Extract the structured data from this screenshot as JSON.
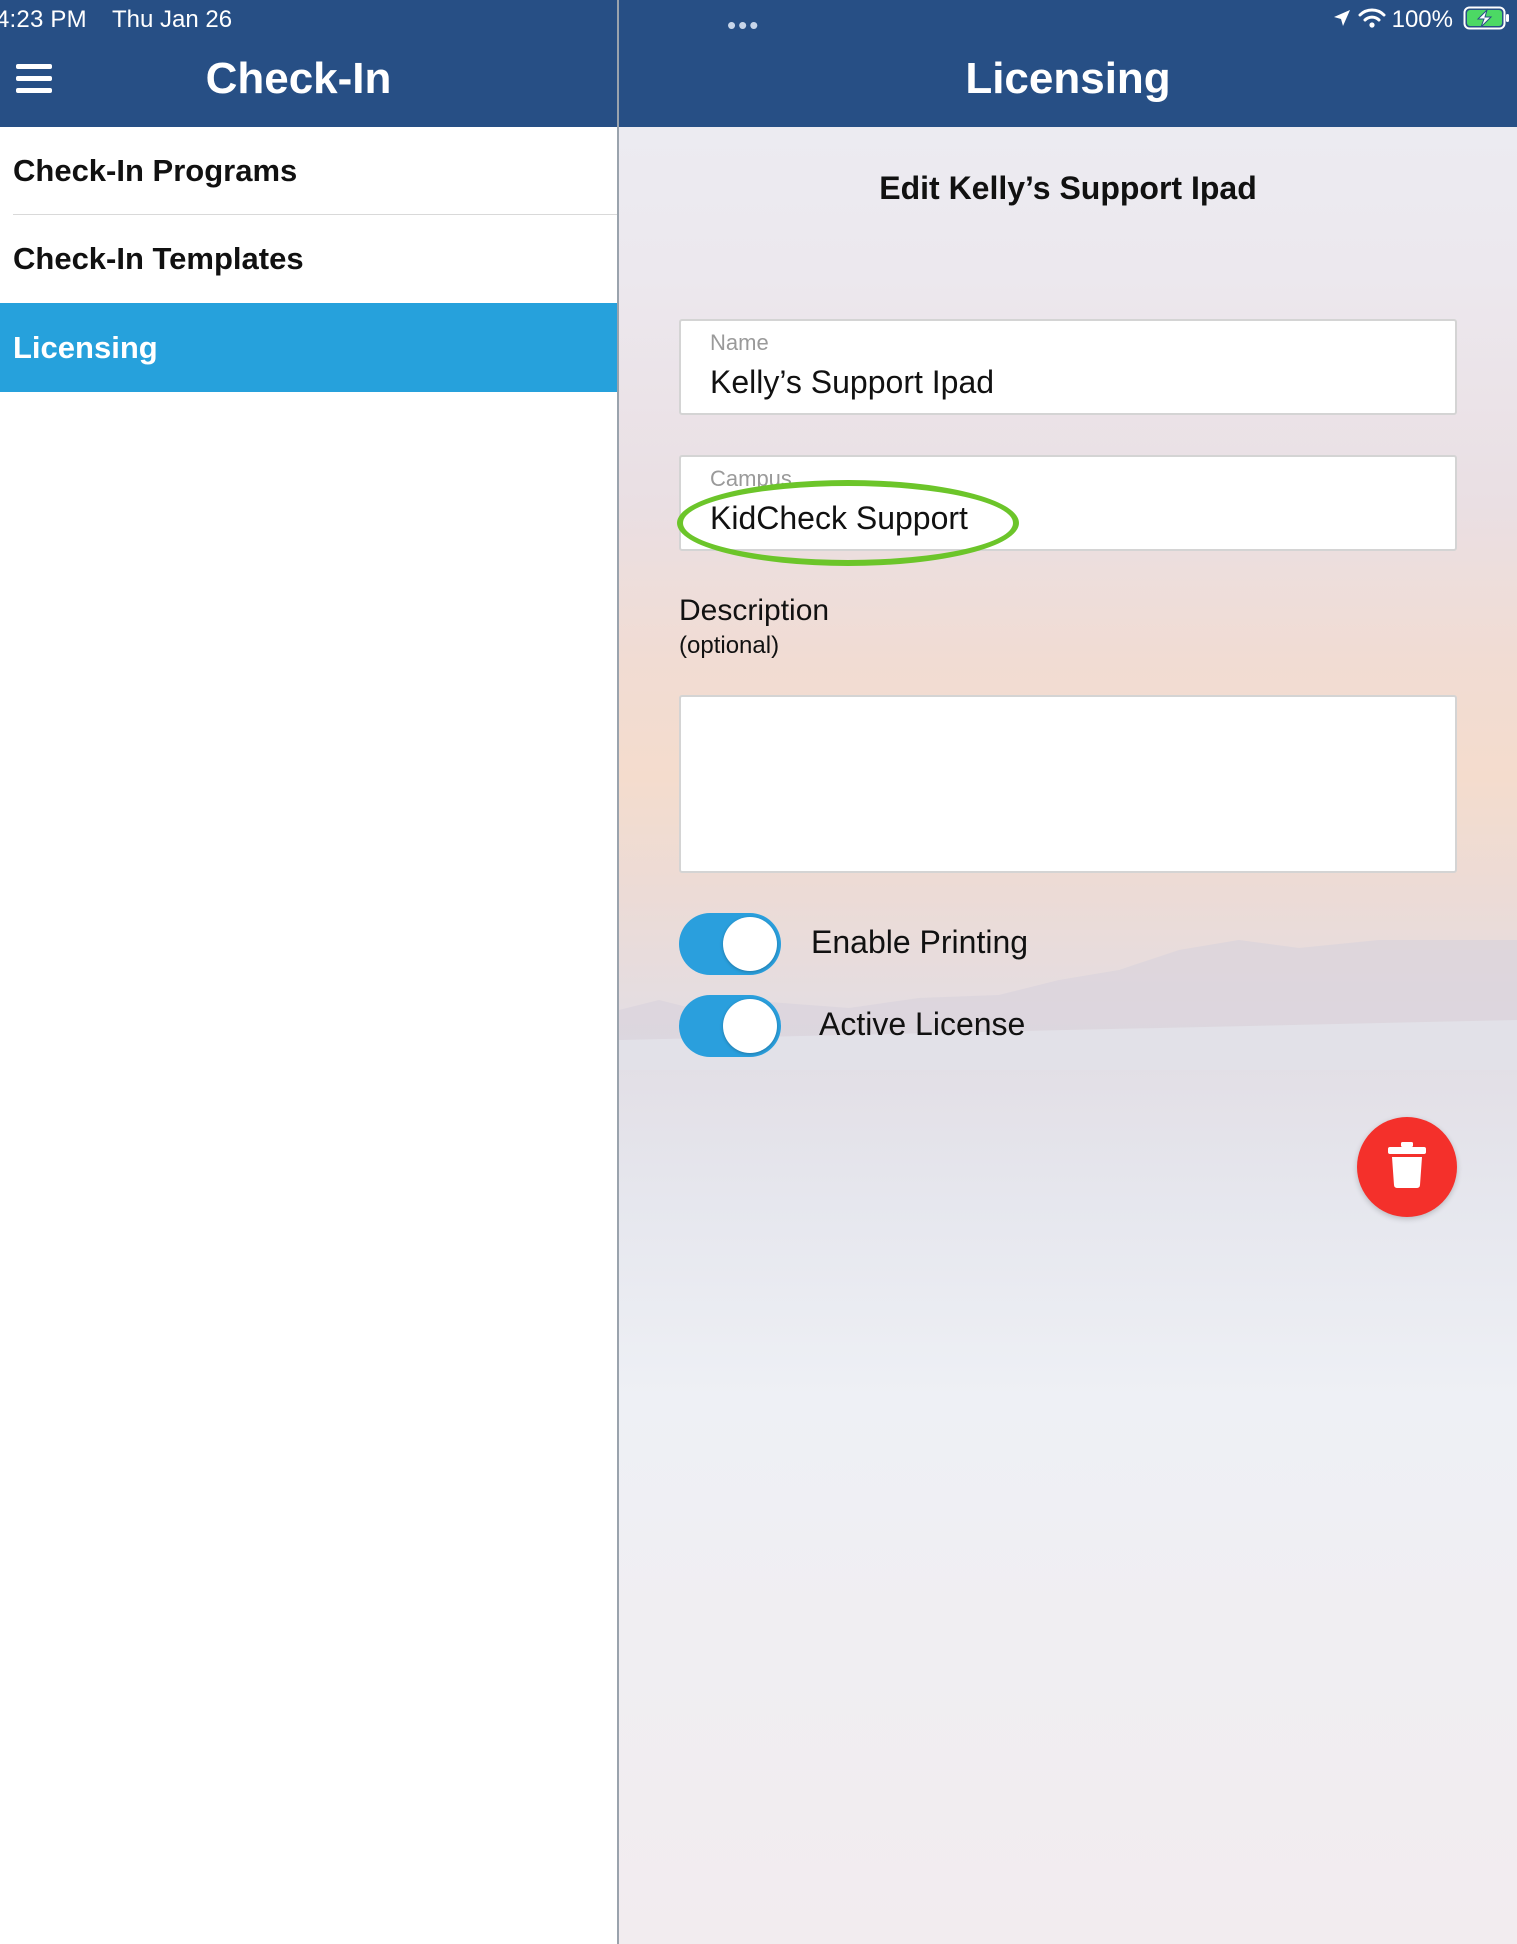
{
  "status_bar": {
    "time": "4:23 PM",
    "date": "Thu Jan 26",
    "battery": "100%"
  },
  "master": {
    "title": "Check-In",
    "nav_items": [
      {
        "label": "Check-In Programs",
        "active": false
      },
      {
        "label": "Check-In Templates",
        "active": false
      },
      {
        "label": "Licensing",
        "active": true
      }
    ]
  },
  "detail": {
    "title": "Licensing",
    "form_title": "Edit Kelly’s Support Ipad",
    "fields": {
      "name": {
        "label": "Name",
        "value": "Kelly’s Support Ipad"
      },
      "campus": {
        "label": "Campus",
        "value": "KidCheck Support"
      },
      "description": {
        "label": "Description",
        "sublabel": "(optional)",
        "value": ""
      }
    },
    "toggles": {
      "enable_printing": {
        "label": "Enable Printing",
        "on": true
      },
      "active_license": {
        "label": "Active License",
        "on": true
      }
    }
  },
  "icons": {
    "menu": "hamburger-menu-icon",
    "location": "location-arrow-icon",
    "wifi": "wifi-icon",
    "battery": "battery-charging-icon",
    "delete": "trash-icon",
    "multitask": "more-dots-icon"
  },
  "colors": {
    "header": "#274f85",
    "nav_active": "#26a1dc",
    "toggle_on": "#2a9fdd",
    "delete": "#f4302b",
    "highlight": "#6cc52a"
  }
}
